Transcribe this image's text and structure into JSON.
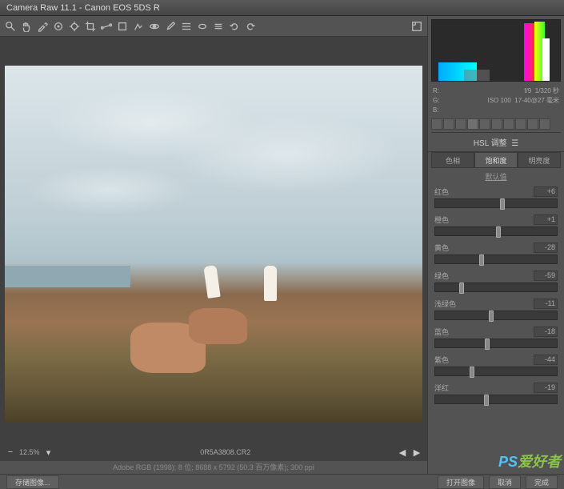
{
  "titlebar": {
    "text": "Camera Raw 11.1  -  Canon EOS 5DS R"
  },
  "toolbar": {
    "icons": [
      "zoom",
      "hand",
      "eyedropper",
      "color-sampler",
      "target",
      "crop",
      "straighten",
      "transform",
      "spot",
      "redeye",
      "brush",
      "grad",
      "radial",
      "wb",
      "rotate-ccw",
      "rotate-cw"
    ]
  },
  "bottom": {
    "zoom": "12.5%",
    "filename": "0R5A3808.CR2"
  },
  "info_line": "Adobe RGB (1998); 8 位; 8688 x 5792 (50.3 百万像素); 300 ppi",
  "metadata": {
    "fstop_label": "f/9",
    "shutter": "1/320 秒",
    "iso": "ISO 100",
    "lens": "17-40@27 毫米"
  },
  "panel": {
    "title": "HSL 调整",
    "tabs": {
      "hue": "色相",
      "sat": "饱和度",
      "lum": "明亮度"
    },
    "defaults": "默认值"
  },
  "sliders": {
    "reds": {
      "label": "红色",
      "value": "+6",
      "pos": 53
    },
    "oranges": {
      "label": "橙色",
      "value": "+1",
      "pos": 50
    },
    "yellows": {
      "label": "黄色",
      "value": "-28",
      "pos": 36
    },
    "greens": {
      "label": "绿色",
      "value": "-59",
      "pos": 20
    },
    "aquas": {
      "label": "浅绿色",
      "value": "-11",
      "pos": 44
    },
    "blues": {
      "label": "蓝色",
      "value": "-18",
      "pos": 41
    },
    "purples": {
      "label": "紫色",
      "value": "-44",
      "pos": 28
    },
    "magentas": {
      "label": "洋红",
      "value": "-19",
      "pos": 40
    }
  },
  "footer": {
    "left": "存储图像...",
    "open": "打开图像",
    "cancel": "取消",
    "done": "完成"
  },
  "watermark": {
    "ps": "PS",
    "cn": "爱好者"
  }
}
